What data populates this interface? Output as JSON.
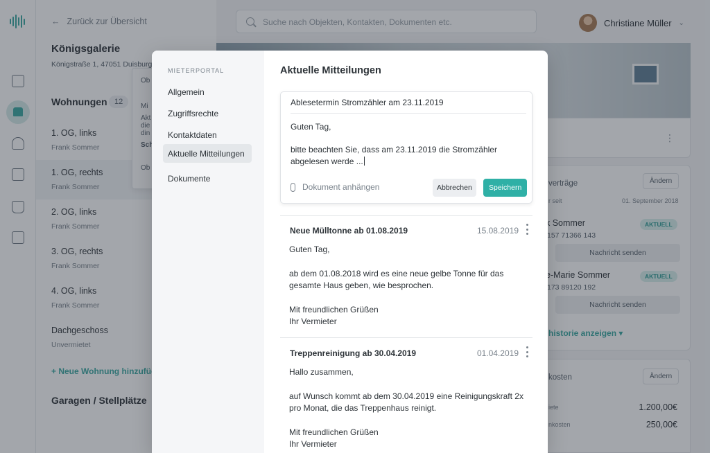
{
  "app": {
    "back_link": "Zurück zur Übersicht",
    "search_placeholder": "Suche nach Objekten, Kontakten, Dokumenten etc.",
    "user_name": "Christiane Müller",
    "accent_color": "#3aa7a0"
  },
  "property": {
    "title": "Königsgalerie",
    "address": "Königstraße 1, 47051 Duisburg",
    "units_heading": "Wohnungen",
    "units_count": "12",
    "units": [
      {
        "name": "1. OG, links",
        "tenant": "Frank Sommer"
      },
      {
        "name": "1. OG, rechts",
        "tenant": "Frank Sommer"
      },
      {
        "name": "2. OG, links",
        "tenant": "Frank Sommer"
      },
      {
        "name": "3. OG, rechts",
        "tenant": "Frank Sommer"
      },
      {
        "name": "4. OG, links",
        "tenant": "Frank Sommer"
      },
      {
        "name": "Dachgeschoss",
        "tenant": "Unvermietet"
      }
    ],
    "add_unit": "+ Neue Wohnung hinzufügen",
    "garages": "Garagen / Stellplätze"
  },
  "popmenu": {
    "items": [
      "Ob",
      "Mi",
      "Akt",
      "die",
      "din",
      "Sch",
      "Ob"
    ]
  },
  "rightpanel": {
    "contracts_title": "verträge",
    "change": "Ändern",
    "since_label": "r seit",
    "since_date": "01. September 2018",
    "tenant1_name": "k Sommer",
    "tenant1_phone": "157 71366 143",
    "status": "AKTUELL",
    "send_message": "Nachricht senden",
    "tenant2_name": "e-Marie Sommer",
    "tenant2_phone": "173 89120 192",
    "history_link": "historie anzeigen ▾",
    "costs_title": "kosten",
    "cost1_label": "iete",
    "cost1_value": "1.200,00€",
    "cost2_label": "nkosten",
    "cost2_value": "250,00€"
  },
  "modal": {
    "sidebar_heading": "MIETERPORTAL",
    "nav": [
      "Allgemein",
      "Zugriffsrechte",
      "Kontaktdaten",
      "Aktuelle Mitteilungen",
      "Dokumente"
    ],
    "active_nav_index": 3,
    "title": "Aktuelle Mitteilungen",
    "editor": {
      "subject": "Ablesetermin Stromzähler am 23.11.2019",
      "greeting": "Guten Tag,",
      "body": "bitte beachten Sie, dass am 23.11.2019 die Stromzähler abgelesen werde ...",
      "attach_label": "Dokument anhängen",
      "cancel_label": "Abbrechen",
      "save_label": "Speichern"
    },
    "messages": [
      {
        "subject": "Neue Mülltonne ab 01.08.2019",
        "date": "15.08.2019",
        "greeting": "Guten Tag,",
        "body": "ab dem 01.08.2018 wird es eine neue gelbe Tonne für das gesamte Haus geben, wie besprochen.",
        "closing": "Mit freundlichen Grüßen",
        "signature": "Ihr Vermieter"
      },
      {
        "subject": "Treppenreinigung ab 30.04.2019",
        "date": "01.04.2019",
        "greeting": "Hallo zusammen,",
        "body": "auf Wunsch kommt ab dem 30.04.2019 eine Reinigungskraft 2x pro Monat, die das Treppenhaus reinigt.",
        "closing": "Mit freundlichen Grüßen",
        "signature": "Ihr Vermieter"
      }
    ]
  }
}
